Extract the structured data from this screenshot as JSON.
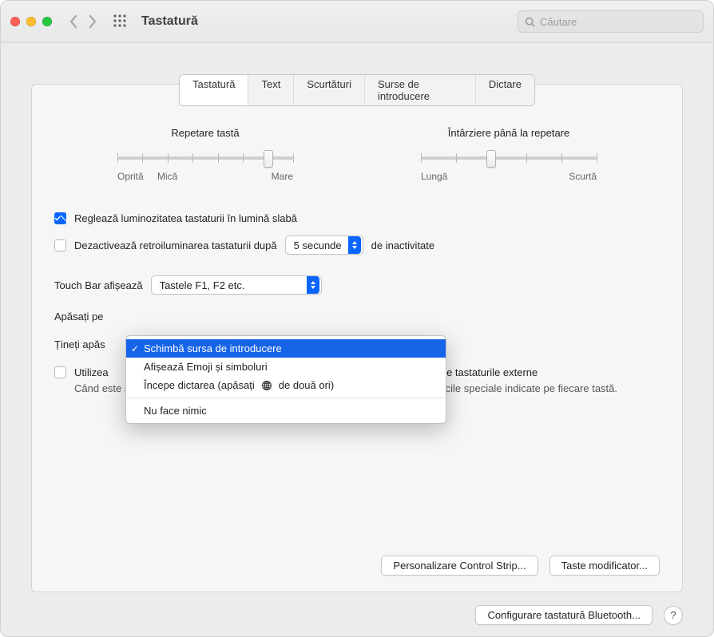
{
  "toolbar": {
    "window_title": "Tastatură",
    "search_placeholder": "Căutare"
  },
  "tabs": {
    "keyboard": "Tastatură",
    "text": "Text",
    "shortcuts": "Scurtături",
    "input_sources": "Surse de introducere",
    "dictation": "Dictare"
  },
  "sliders": {
    "key_repeat": {
      "title": "Repetare tastă",
      "left_label": "Oprită",
      "mid_label": "Mică",
      "right_label": "Mare"
    },
    "delay_repeat": {
      "title": "Întârziere până la repetare",
      "left_label": "Lungă",
      "right_label": "Scurtă"
    }
  },
  "checks": {
    "low_light": "Reglează luminozitatea tastaturii în lumină slabă",
    "backlight_off_prefix": "Dezactivează retroiluminarea tastaturii după",
    "backlight_off_suffix": "de inactivitate",
    "backlight_off_value": "5 secunde"
  },
  "touchbar": {
    "label": "Touch Bar afișează",
    "value": "Tastele F1, F2 etc."
  },
  "press_row_prefix": "Apăsați pe",
  "hold_row_prefix": "Țineți apăs",
  "fn_row": {
    "checkbox_text_prefix": "Utilizea",
    "checkbox_text_suffix": "ndard pe tastaturile externe",
    "desc_line": "Când este selectată această opțiune, apăsați tasta Fn pentru a utiliza caracteristicile speciale indicate pe fiecare tastă."
  },
  "dropdown": {
    "change_input": "Schimbă sursa de introducere",
    "emoji": "Afișează Emoji și simboluri",
    "dictation_prefix": "Începe dictarea (apăsați",
    "dictation_suffix": "de două ori)",
    "do_nothing": "Nu face nimic"
  },
  "buttons": {
    "control_strip": "Personalizare Control Strip...",
    "modifier_keys": "Taste modificator...",
    "bluetooth": "Configurare tastatură Bluetooth..."
  }
}
